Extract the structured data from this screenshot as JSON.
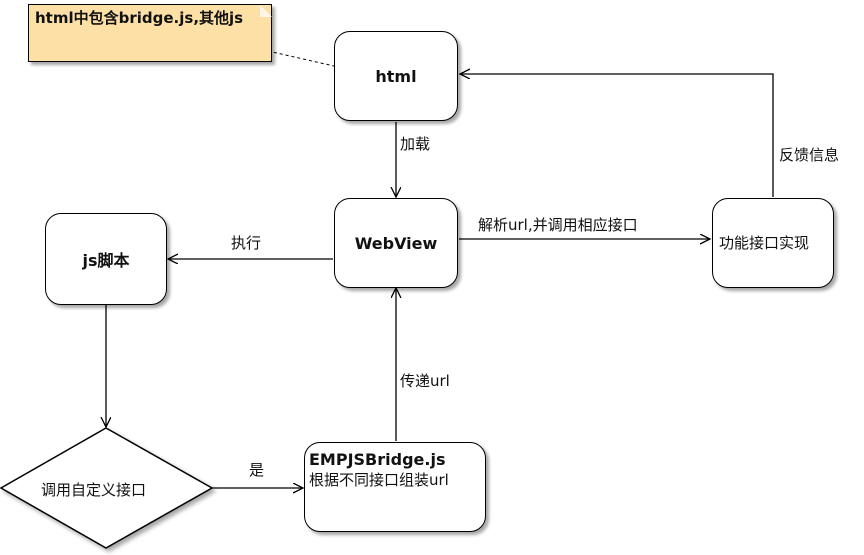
{
  "note": {
    "text": "html中包含bridge.js,其他js"
  },
  "nodes": {
    "html": "html",
    "webview": "WebView",
    "js_script": "js脚本",
    "func_impl": "功能接口实现",
    "decision": "调用自定义接口",
    "bridge_line1": "EMPJSBridge.js",
    "bridge_line2": "根据不同接口组装url"
  },
  "edges": {
    "load": "加载",
    "execute": "执行",
    "parse": "解析url,并调用相应接口",
    "feedback": "反馈信息",
    "pass_url": "传递url",
    "yes": "是"
  }
}
